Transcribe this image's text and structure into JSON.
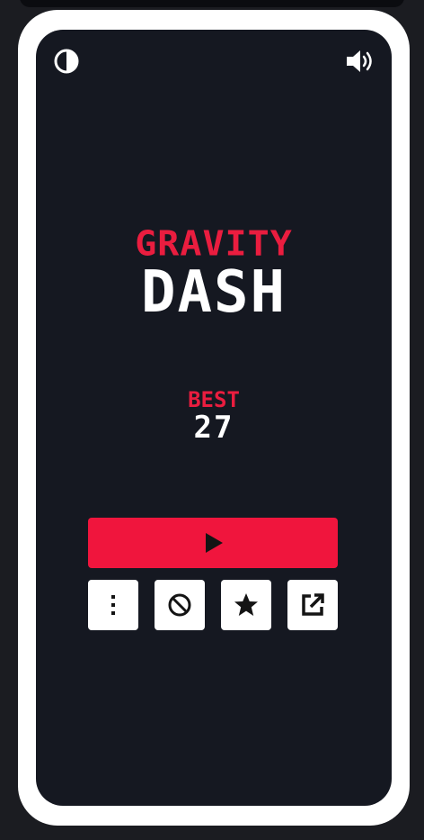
{
  "title": {
    "top": "GRAVITY",
    "main": "DASH"
  },
  "best": {
    "label": "BEST",
    "value": "27"
  },
  "colors": {
    "accent": "#f0153d",
    "title_red": "#ea1d3f",
    "screen_bg": "#151821",
    "frame": "#ffffff"
  },
  "controls": {
    "theme_toggle_icon": "contrast-icon",
    "sound_toggle_icon": "volume-icon",
    "play_icon": "play-icon",
    "actions": [
      {
        "icon": "more-vertical-icon"
      },
      {
        "icon": "no-ads-icon"
      },
      {
        "icon": "star-icon"
      },
      {
        "icon": "share-icon"
      }
    ]
  }
}
